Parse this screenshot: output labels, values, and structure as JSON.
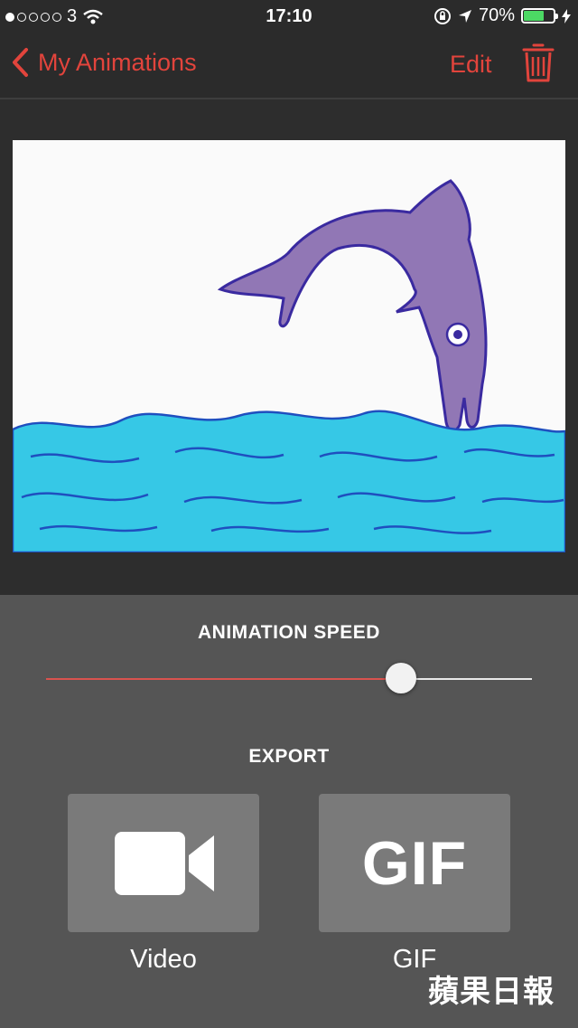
{
  "status_bar": {
    "carrier": "3",
    "time": "17:10",
    "battery": "70%",
    "battery_level": 0.7,
    "signal_bars_filled": 1,
    "signal_bars_total": 5
  },
  "nav": {
    "back_label": "My Animations",
    "edit_label": "Edit",
    "accent_color": "#e2443c"
  },
  "speed": {
    "title": "ANIMATION SPEED",
    "value": 0.73
  },
  "export": {
    "title": "EXPORT",
    "video_label": "Video",
    "gif_label": "GIF",
    "gif_icon_text": "GIF"
  },
  "watermark": "蘋果日報"
}
